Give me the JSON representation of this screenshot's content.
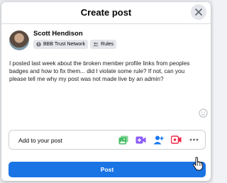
{
  "dialog": {
    "title": "Create post",
    "close_icon": "close-icon"
  },
  "author": {
    "name": "Scott Hendison",
    "audience_label": "BBB Trust Network",
    "rules_label": "Rules"
  },
  "post": {
    "text": "I posted last week about the broken member profile links from peoples badges and how to fix them... did I violate some rule? If not, can you please tell me why my post was not made live by an admin?"
  },
  "add_to_post": {
    "label": "Add to your post",
    "icons": [
      "photo-video-icon",
      "video-icon",
      "tag-people-icon",
      "live-video-icon",
      "more-icon"
    ]
  },
  "actions": {
    "post_label": "Post"
  },
  "colors": {
    "primary": "#1b74e4",
    "photo": "#45bd62",
    "video": "#8b5cf6",
    "tag": "#1877f2",
    "live": "#f02849"
  }
}
